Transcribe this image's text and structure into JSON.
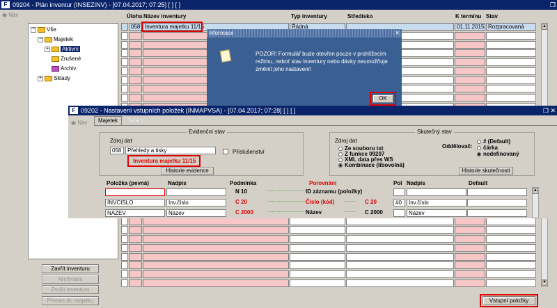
{
  "main_window": {
    "title": "09204 - Plán inventur (INSEZINV) - [07.04.2017; 07:25]  [ ]  [ ]",
    "nav_label": "Nav",
    "restore_close": "❐"
  },
  "tree": {
    "root": "Vše",
    "majetek": "Majetek",
    "aktivni": "Aktivní",
    "zrusene": "Zrušené",
    "archiv": "Archiv",
    "sklady": "Sklady"
  },
  "grid": {
    "headers": {
      "uloha": "Úloha",
      "nazev": "Název inventury",
      "typ": "Typ inventury",
      "stredisko": "Středisko",
      "k_terminu": "K termínu",
      "stav": "Stav"
    },
    "row1": {
      "uloha": "058",
      "nazev": "Inventura majetku 11/15",
      "typ": "Řádná",
      "stredisko": "",
      "k_terminu": "01.11.2015",
      "stav": "Rozpracovaná"
    }
  },
  "left_buttons": {
    "zavrit": "Zavřít inventuru",
    "archivace": "Archivace",
    "zrusit": "Zrušit inventuru",
    "prenos": "Přenos do majetku"
  },
  "vstupni_button": "Vstupní položky",
  "dialog": {
    "title": "Informace",
    "message": "POZOR! Formulář bude otevřen pouze v prohlížecím režimu, neboť stav inventury nebo dávky neumožňuje změnit jeho nastavení!",
    "ok": "OK",
    "close": "✕"
  },
  "second_window": {
    "title": "09202 - Nastavení vstupních položek (INMAPVSA) - [07.04.2017; 07:28]  [ ]  [ ]",
    "nav_label": "Nav",
    "tabs": [
      "Majetek",
      "Sklady"
    ],
    "evidencni": {
      "title": "Evidenční stav",
      "zdroj_label": "Zdroj dat",
      "zdroj_code": "058",
      "zdroj_name": "Přehledy a tisky",
      "inventura": "Inventura majetku 11/15",
      "prislusenstvi": "Příslušenství",
      "historie_btn": "Historie evidence"
    },
    "skutecny": {
      "title": "Skutečný stav",
      "zdroj_label": "Zdroj dat",
      "options": [
        "Ze souboru txt",
        "Z funkce 09207",
        "XML data přes WS",
        "Kombinace (libovolná)"
      ],
      "selected": "Kombinace (libovolná)",
      "oddelovac_label": "Oddělovač:",
      "oddelovac_options": [
        "# (Default)",
        "čárka",
        "nedefinovaný"
      ],
      "oddelovac_selected": "nedefinovaný",
      "historie_btn": "Historie skutečnosti"
    },
    "table": {
      "headers": {
        "polozka": "Položka  (pevná)",
        "nadpis": "Nadpis",
        "podminka": "Podmínka",
        "porovnani": "Porovnání",
        "pol": "Pol",
        "nadpis2": "Nadpis",
        "default": "Default"
      },
      "rows": [
        {
          "polozka": "",
          "nadpis": "",
          "podminka": "N 10",
          "porovnani": "ID záznamu (položky)",
          "cmp": "",
          "pol": "",
          "nadpis2": "",
          "default": ""
        },
        {
          "polozka": "INVCISLO",
          "nadpis": "Inv.číslo",
          "podminka": "C 20",
          "porovnani": "Číslo (kód)",
          "cmp": "C 20",
          "pol": "#0",
          "nadpis2": "Inv.číslo",
          "default": ""
        },
        {
          "polozka": "NAZEV",
          "nadpis": "Název",
          "podminka": "C 2000",
          "porovnani": "Název",
          "cmp": "C 2000",
          "pol": "",
          "nadpis2": "Název",
          "default": ""
        }
      ]
    }
  },
  "colors": {
    "titlebar": "#0a246a",
    "highlight_red": "#e00000",
    "pink": "#f7c7c7",
    "dialog_bg": "#3a5f92"
  }
}
